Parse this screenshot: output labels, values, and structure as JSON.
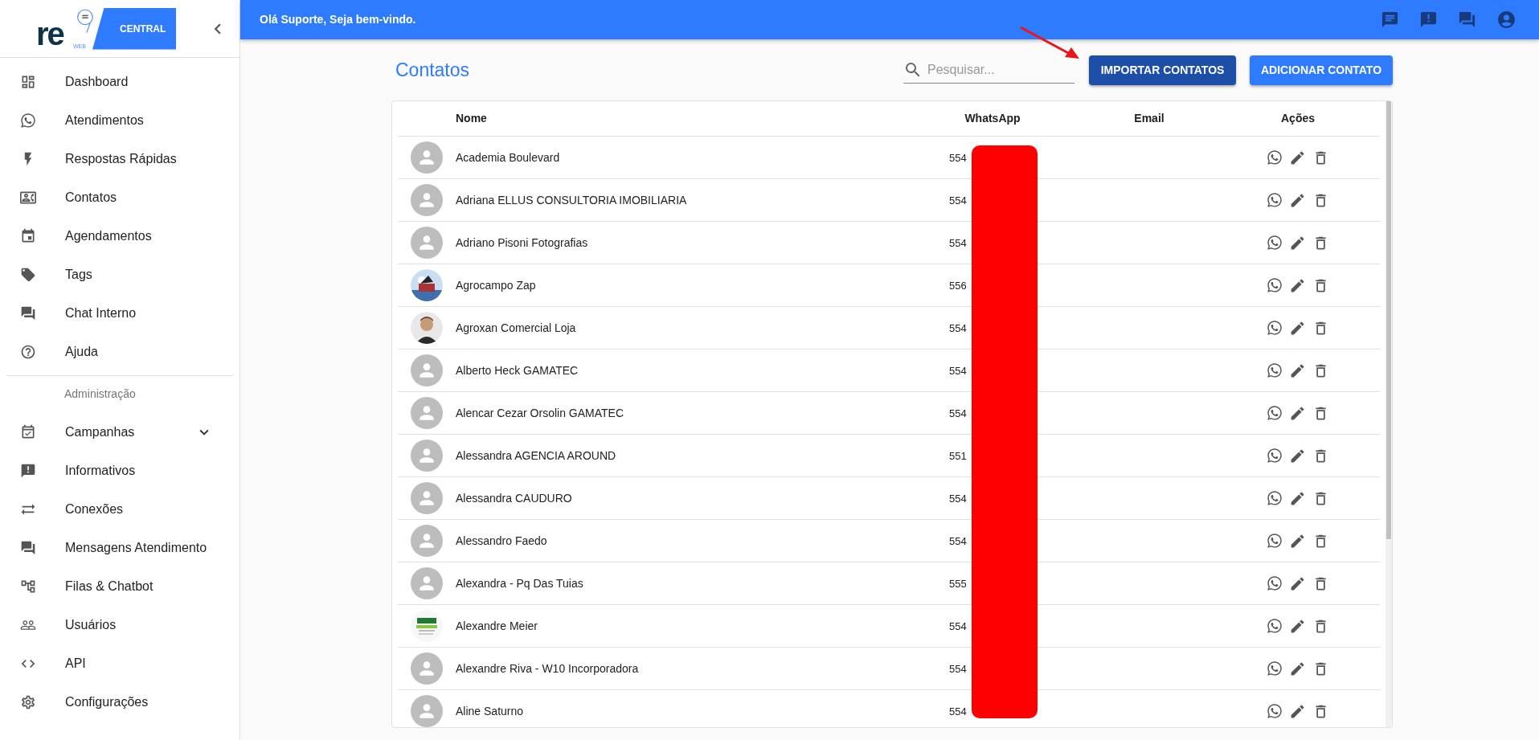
{
  "logo": {
    "wordmark": "re",
    "sub": "WEB",
    "banner": "CENTRAL"
  },
  "header": {
    "greeting": "Olá Suporte, Seja bem-vindo."
  },
  "sidebar": {
    "items": [
      {
        "label": "Dashboard"
      },
      {
        "label": "Atendimentos"
      },
      {
        "label": "Respostas Rápidas"
      },
      {
        "label": "Contatos"
      },
      {
        "label": "Agendamentos"
      },
      {
        "label": "Tags"
      },
      {
        "label": "Chat Interno"
      },
      {
        "label": "Ajuda"
      }
    ],
    "section_title": "Administração",
    "admin_items": [
      {
        "label": "Campanhas",
        "expanded": false
      },
      {
        "label": "Informativos"
      },
      {
        "label": "Conexões"
      },
      {
        "label": "Mensagens Atendimento"
      },
      {
        "label": "Filas & Chatbot"
      },
      {
        "label": "Usuários"
      },
      {
        "label": "API"
      },
      {
        "label": "Configurações"
      }
    ]
  },
  "page": {
    "title": "Contatos",
    "search": {
      "placeholder": "Pesquisar..."
    },
    "buttons": [
      {
        "label": "IMPORTAR CONTATOS",
        "kind": "secondary"
      },
      {
        "label": "ADICIONAR CONTATO",
        "kind": "primary"
      }
    ]
  },
  "table": {
    "columns": [
      "Nome",
      "WhatsApp",
      "Email",
      "Ações"
    ],
    "rows": [
      {
        "avatar": {
          "kind": "default"
        },
        "name": "Academia Boulevard",
        "whatsapp": "554"
      },
      {
        "avatar": {
          "kind": "default"
        },
        "name": "Adriana ELLUS CONSULTORIA IMOBILIARIA",
        "whatsapp": "554"
      },
      {
        "avatar": {
          "kind": "default"
        },
        "name": "Adriano Pisoni Fotografias",
        "whatsapp": "554"
      },
      {
        "name": "Agrocampo Zap",
        "whatsapp": "556"
      },
      {
        "name": "Agroxan Comercial Loja",
        "whatsapp": "554"
      },
      {
        "avatar": {
          "kind": "default"
        },
        "name": "Alberto Heck GAMATEC",
        "whatsapp": "554"
      },
      {
        "avatar": {
          "kind": "default"
        },
        "name": "Alencar Cezar Orsolin GAMATEC",
        "whatsapp": "554"
      },
      {
        "avatar": {
          "kind": "default"
        },
        "name": "Alessandra AGENCIA AROUND",
        "whatsapp": "551"
      },
      {
        "avatar": {
          "kind": "default"
        },
        "name": "Alessandra CAUDURO",
        "whatsapp": "554"
      },
      {
        "avatar": {
          "kind": "default"
        },
        "name": "Alessandro Faedo",
        "whatsapp": "554"
      },
      {
        "avatar": {
          "kind": "default"
        },
        "name": "Alexandra - Pq Das Tuias",
        "whatsapp": "555"
      },
      {
        "name": "Alexandre Meier",
        "whatsapp": "554"
      },
      {
        "avatar": {
          "kind": "default"
        },
        "name": "Alexandre Riva - W10 Incorporadora",
        "whatsapp": "554"
      },
      {
        "avatar": {
          "kind": "default"
        },
        "name": "Aline Saturno",
        "whatsapp": "554"
      }
    ]
  }
}
